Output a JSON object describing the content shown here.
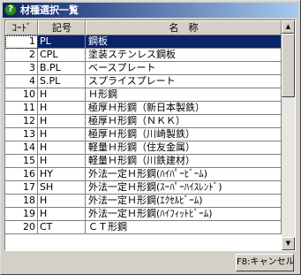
{
  "window": {
    "title": "材種選択一覧",
    "help_icon": "?"
  },
  "table": {
    "headers": {
      "code": "ｺｰﾄﾞ",
      "symbol": "記号",
      "name": "名　称"
    },
    "rows": [
      {
        "code": "1",
        "symbol": "PL",
        "name": "鋼板",
        "selected": true
      },
      {
        "code": "2",
        "symbol": "CPL",
        "name": "塗装ステンレス鋼板"
      },
      {
        "code": "3",
        "symbol": "B.PL",
        "name": "ベースプレート"
      },
      {
        "code": "4",
        "symbol": "S.PL",
        "name": "スプライスプレート"
      },
      {
        "code": "10",
        "symbol": "H",
        "name": "Ｈ形鋼"
      },
      {
        "code": "11",
        "symbol": "H",
        "name": "極厚Ｈ形鋼（新日本製鉄）"
      },
      {
        "code": "12",
        "symbol": "H",
        "name": "極厚Ｈ形鋼（ＮＫＫ）"
      },
      {
        "code": "13",
        "symbol": "H",
        "name": "極厚Ｈ形鋼（川崎製鉄）"
      },
      {
        "code": "14",
        "symbol": "H",
        "name": "軽量Ｈ形鋼（住友金属）"
      },
      {
        "code": "15",
        "symbol": "H",
        "name": "軽量Ｈ形鋼（川鉄建材）"
      },
      {
        "code": "16",
        "symbol": "HY",
        "name": "外法一定Ｈ形鋼(ﾊｲﾊﾟｰﾋﾞｰﾑ)"
      },
      {
        "code": "17",
        "symbol": "SH",
        "name": "外法一定Ｈ形鋼(ｽｰﾊﾟｰﾊｲｽﾚﾝﾄﾞ)"
      },
      {
        "code": "18",
        "symbol": "H",
        "name": "外法一定Ｈ形鋼(ｴｸｾﾙﾋﾞｰﾑ)"
      },
      {
        "code": "19",
        "symbol": "H",
        "name": "外法一定Ｈ形鋼(ﾊｲﾌｨｯﾄﾋﾞｰﾑ)"
      },
      {
        "code": "20",
        "symbol": "CT",
        "name": "ＣＴ形鋼"
      }
    ]
  },
  "scrollbar": {
    "up_arrow": "▲",
    "down_arrow": "▼"
  },
  "footer": {
    "cancel_label": "F8:キャンセル"
  }
}
